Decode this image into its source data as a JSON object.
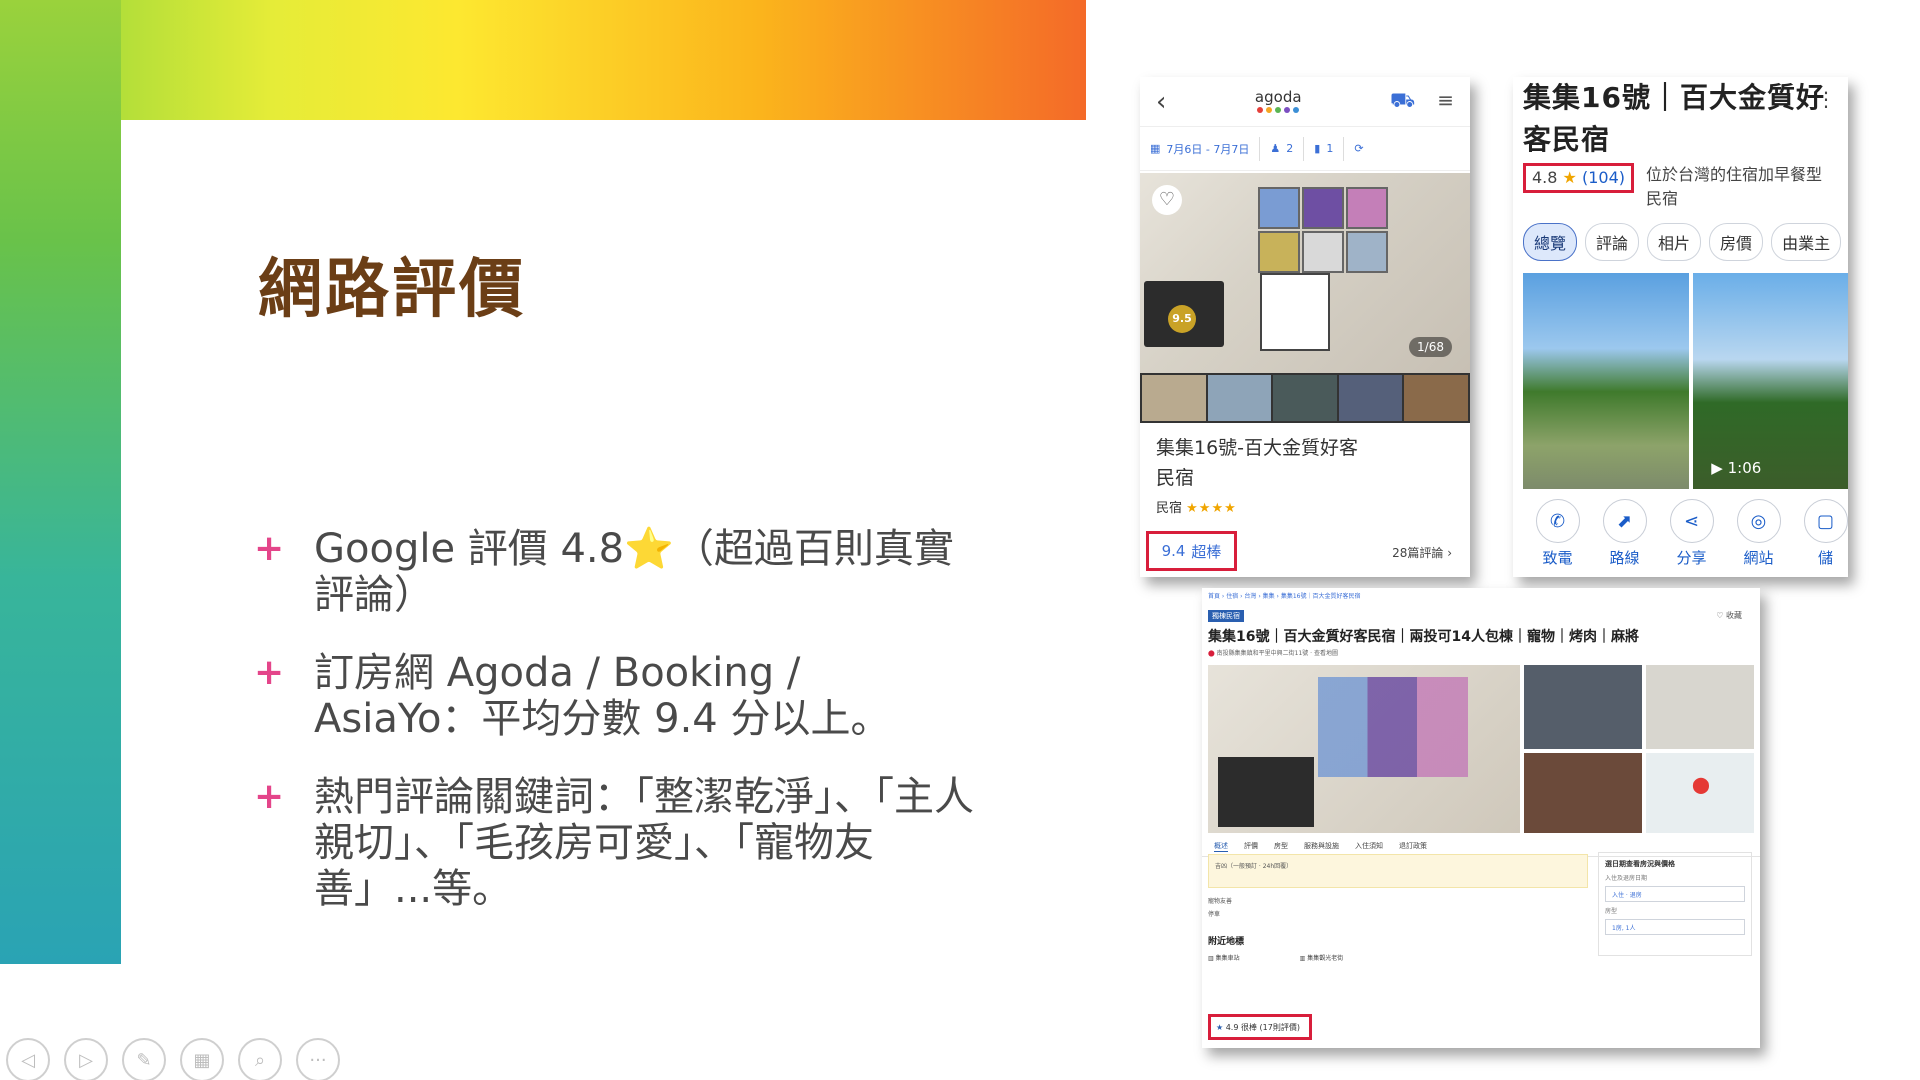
{
  "slide": {
    "title": "網路評價",
    "bullets": [
      {
        "marker": "+",
        "text_a": "Google 評價 4.8",
        "star": "⭐",
        "text_b": "（超過百則真實評論）"
      },
      {
        "marker": "+",
        "text_a": "訂房網 Agoda / Booking / AsiaYo：平均分數 9.4 分以上。",
        "star": "",
        "text_b": ""
      },
      {
        "marker": "+",
        "text_a": "熱門評論關鍵詞：「整潔乾淨」、「主人親切」、「毛孩房可愛」、「寵物友善」...等。",
        "star": "",
        "text_b": ""
      }
    ]
  },
  "agoda": {
    "logo": "agoda",
    "dates": "7月6日 - 7月7日",
    "guests": "2",
    "rooms": "1",
    "photo_count": "1/68",
    "hotel_name": "集集16號-百大金質好客民宿",
    "type_label": "民宿",
    "stars": "★★★★",
    "score": "9.4",
    "score_label": "超棒",
    "reviews": "28篇評論",
    "award_score": "9.5"
  },
  "google": {
    "title": "集集16號｜百大金質好客民宿",
    "rating": "4.8",
    "rating_star": "★",
    "rating_count": "(104)",
    "description": "位於台灣的住宿加早餐型民宿",
    "chips": [
      "總覽",
      "評論",
      "相片",
      "房價",
      "由業主"
    ],
    "video_duration": "▶ 1:06",
    "actions": [
      {
        "label": "致電",
        "glyph": "✆"
      },
      {
        "label": "路線",
        "glyph": "⬈"
      },
      {
        "label": "分享",
        "glyph": "⋖"
      },
      {
        "label": "網站",
        "glyph": "◎"
      },
      {
        "label": "儲",
        "glyph": "▢"
      }
    ]
  },
  "booking": {
    "breadcrumb": "首頁 › 住宿 › 台灣 › 集集 › 集集16號｜百大金質好客民宿",
    "tag": "獨棟民宿",
    "fav": "♡ 收藏",
    "title": "集集16號｜百大金質好客民宿｜兩投可14人包棟｜寵物｜烤肉｜麻將",
    "address": "南投縣集集鎮和平里中興二街11號 · 查看地圖",
    "tabs": [
      "概述",
      "評價",
      "房型",
      "服務與設施",
      "入住須知",
      "退訂政策"
    ],
    "notice": "吉凶（一般預訂 · 24h回覆）",
    "line1": "寵物友善",
    "line2": "停車",
    "nearby": "附近地標",
    "loc1": "集集車站",
    "loc2": "集集觀光老街",
    "side_title": "選日期查看房況與價格",
    "side_label1": "入住及退房日期",
    "side_label2": "房型",
    "field1": "入住 · 退房",
    "field2": "1房, 1人",
    "score": "4.9",
    "score_label": "很棒 (17則評價)",
    "score_star": "★"
  },
  "controls": [
    "◁",
    "▷",
    "✎",
    "▦",
    "⌕",
    "···"
  ],
  "colors": {
    "title_brown": "#6b3e16",
    "bullet_plus": "#e4458a",
    "highlight_red": "#d81e3b",
    "link_blue": "#1a5cc8"
  }
}
